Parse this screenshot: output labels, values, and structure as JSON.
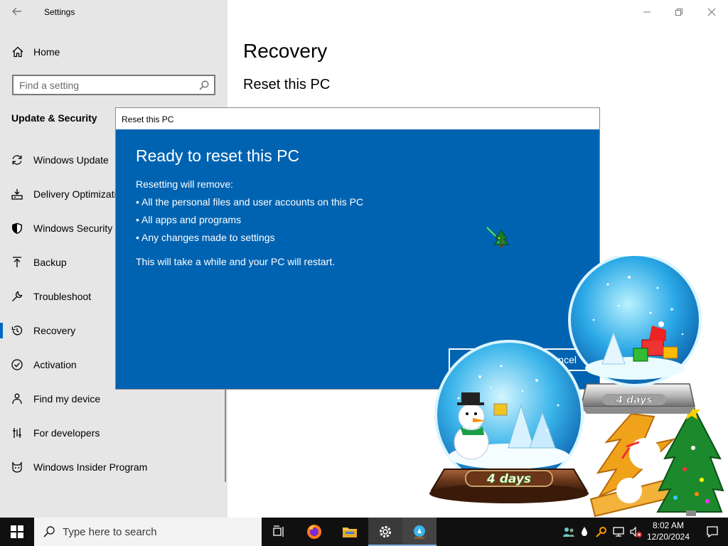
{
  "window": {
    "title": "Settings",
    "home_label": "Home",
    "search_placeholder": "Find a setting",
    "section_title": "Update & Security"
  },
  "sidebar": {
    "items": [
      {
        "label": "Windows Update",
        "icon": "refresh-icon"
      },
      {
        "label": "Delivery Optimization",
        "icon": "delivery-icon"
      },
      {
        "label": "Windows Security",
        "icon": "shield-icon"
      },
      {
        "label": "Backup",
        "icon": "backup-arrow-icon"
      },
      {
        "label": "Troubleshoot",
        "icon": "wrench-icon"
      },
      {
        "label": "Recovery",
        "icon": "history-icon",
        "selected": true
      },
      {
        "label": "Activation",
        "icon": "check-circle-icon"
      },
      {
        "label": "Find my device",
        "icon": "person-pin-icon"
      },
      {
        "label": "For developers",
        "icon": "developer-icon"
      },
      {
        "label": "Windows Insider Program",
        "icon": "insider-cat-icon"
      }
    ]
  },
  "main": {
    "title": "Recovery",
    "subtitle": "Reset this PC"
  },
  "dialog": {
    "window_title": "Reset this PC",
    "heading": "Ready to reset this PC",
    "intro": "Resetting will remove:",
    "bullets": [
      "• All the personal files and user accounts on this PC",
      "• All apps and programs",
      "• Any changes made to settings"
    ],
    "note": "This will take a while and your PC will restart.",
    "cancel_label": "Cancel"
  },
  "decor": {
    "globe_back_label": "4 days",
    "globe_front_label": "4 days"
  },
  "taskbar": {
    "search_placeholder": "Type here to search",
    "time": "8:02 AM",
    "date": "12/20/2024"
  },
  "colors": {
    "dialog_blue": "#0063b1",
    "accent": "#0067c0",
    "sidebar_bg": "#e6e6e6",
    "taskbar_bg": "#101010"
  }
}
